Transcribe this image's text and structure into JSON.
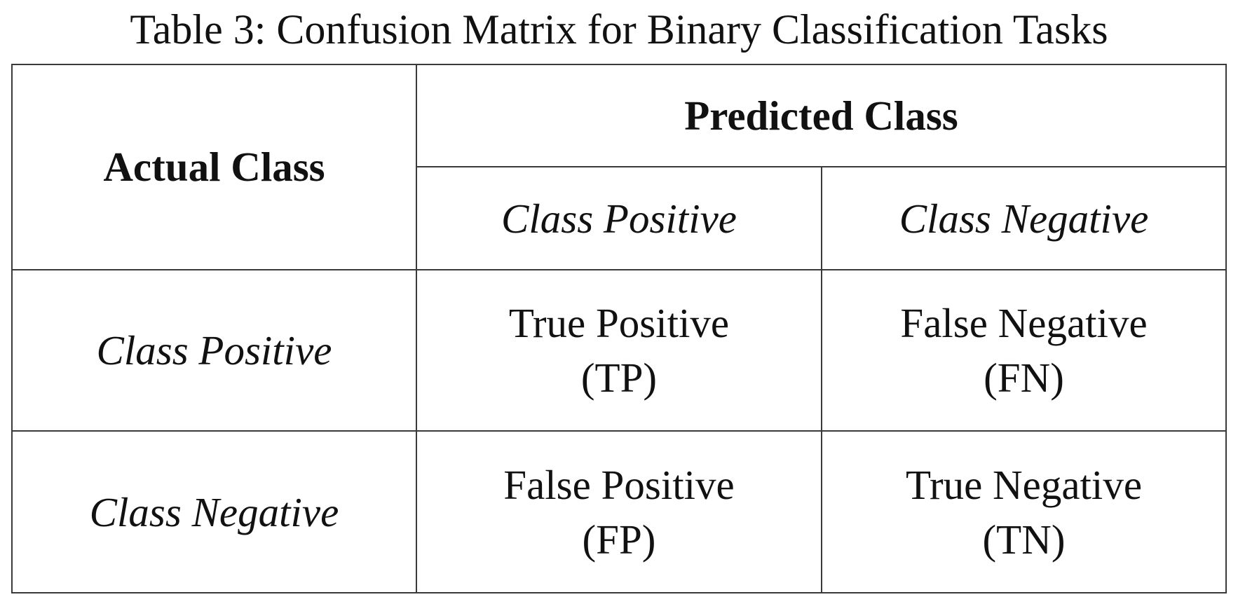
{
  "caption": "Table 3: Confusion Matrix for Binary Classification Tasks",
  "table": {
    "corner_header": "Actual Class",
    "predicted_header": "Predicted Class",
    "column_headers": [
      "Class Positive",
      "Class Negative"
    ],
    "rows": [
      {
        "label": "Class Positive",
        "cells": [
          {
            "text": "True Positive",
            "abbr": "(TP)"
          },
          {
            "text": "False Negative",
            "abbr": "(FN)"
          }
        ]
      },
      {
        "label": "Class Negative",
        "cells": [
          {
            "text": "False Positive",
            "abbr": "(FP)"
          },
          {
            "text": "True Negative",
            "abbr": "(TN)"
          }
        ]
      }
    ]
  }
}
